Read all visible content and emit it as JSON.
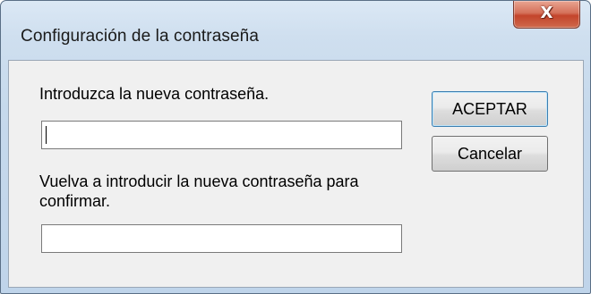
{
  "window": {
    "title": "Configuración de la contraseña",
    "close_icon": "close-icon",
    "close_glyph": "X"
  },
  "form": {
    "new_password_label": "Introduzca la nueva contraseña.",
    "new_password_value": "",
    "confirm_password_label": "Vuelva a introducir la nueva contraseña para confirmar.",
    "confirm_password_value": ""
  },
  "buttons": {
    "ok_label": "ACEPTAR",
    "cancel_label": "Cancelar"
  }
}
